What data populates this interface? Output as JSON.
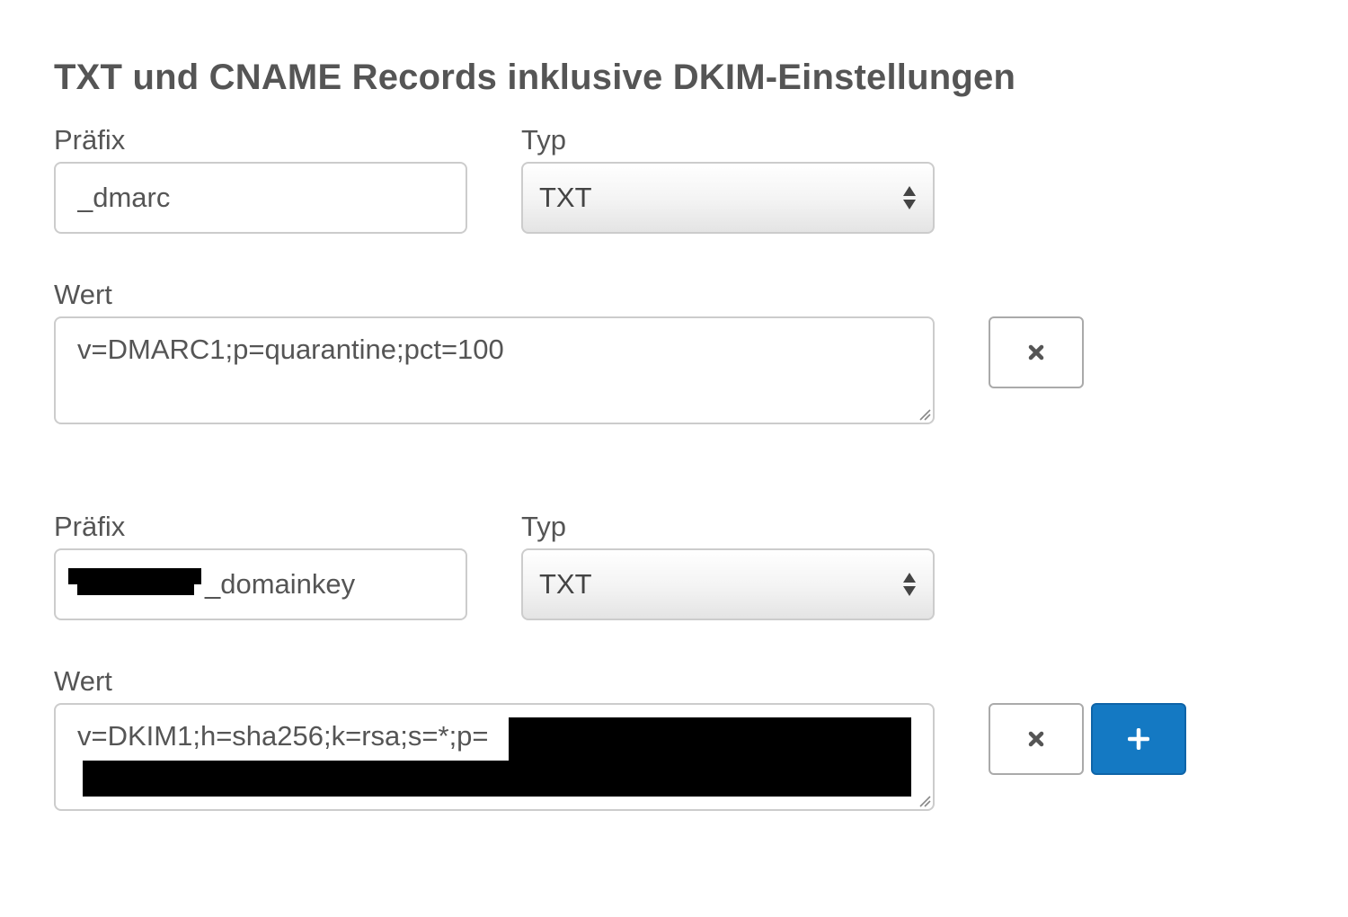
{
  "page": {
    "title": "TXT und CNAME Records inklusive DKIM-Einstellungen"
  },
  "records": [
    {
      "prefix_label": "Präfix",
      "prefix_value": "_dmarc",
      "type_label": "Typ",
      "type_value": "TXT",
      "value_label": "Wert",
      "value_text": "v=DMARC1;p=quarantine;pct=100",
      "remove_icon": "times-icon"
    },
    {
      "prefix_label": "Präfix",
      "prefix_value": "_domainkey",
      "prefix_redacted": true,
      "type_label": "Typ",
      "type_value": "TXT",
      "value_label": "Wert",
      "value_text": "v=DKIM1;h=sha256;k=rsa;s=*;p=",
      "value_redacted": true,
      "remove_icon": "times-icon",
      "add_icon": "plus-icon"
    }
  ],
  "colors": {
    "text": "#555555",
    "border": "#cccccc",
    "add_button": "#1479c3",
    "redaction": "#000000"
  }
}
